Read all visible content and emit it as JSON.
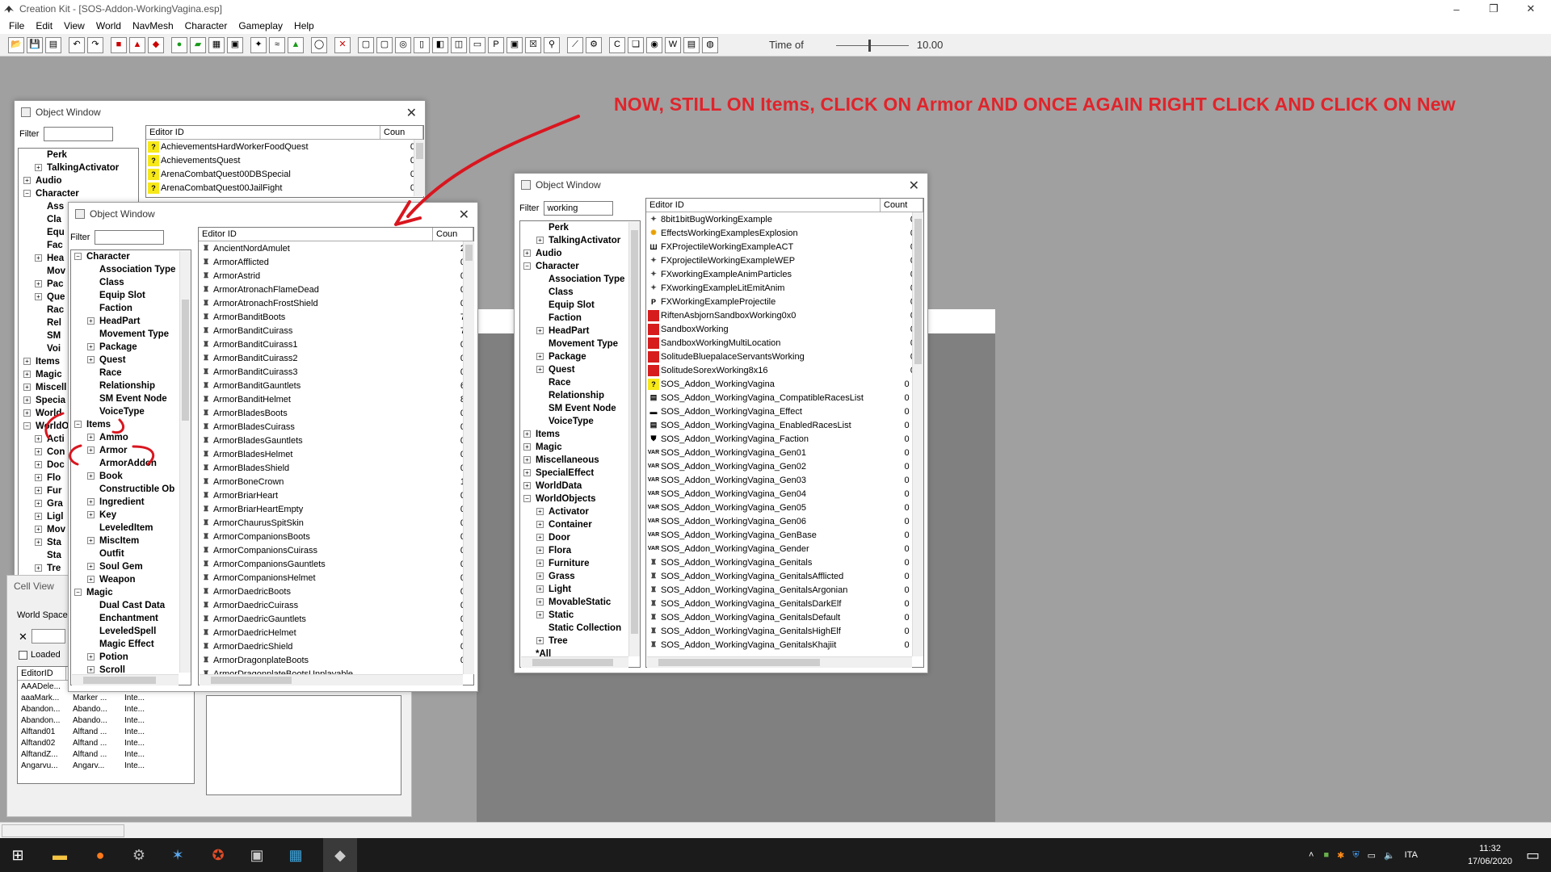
{
  "app": {
    "title": "Creation Kit - [SOS-Addon-WorkingVagina.esp]",
    "menus": [
      "File",
      "Edit",
      "View",
      "World",
      "NavMesh",
      "Character",
      "Gameplay",
      "Help"
    ],
    "time_of_day_label": "Time of",
    "time_of_day_value": "10.00"
  },
  "annotation": {
    "instruction": "NOW, STILL ON  Items, CLICK ON  Armor  AND ONCE AGAIN RIGHT CLICK AND CLICK ON  New",
    "color": "#e0242b"
  },
  "back_object_window": {
    "title": "Object Window",
    "filter_label": "Filter",
    "filter_value": "",
    "tree": [
      "Perk",
      "TalkingActivator",
      "Audio",
      "Character",
      "Ass",
      "Cla",
      "Equ",
      "Fac",
      "Hea",
      "Mov",
      "Pac",
      "Que",
      "Rac",
      "Rel",
      "SM",
      "Voi",
      "Items",
      "Magic",
      "Miscell",
      "Specia",
      "World",
      "WorldO",
      "Acti",
      "Con",
      "Doc",
      "Flo",
      "Fur",
      "Gra",
      "Ligl",
      "Mov",
      "Sta",
      "Sta",
      "Tre"
    ],
    "columns": [
      "Editor ID",
      "Coun"
    ],
    "rows": [
      {
        "name": "AchievementsHardWorkerFoodQuest",
        "count": "0"
      },
      {
        "name": "AchievementsQuest",
        "count": "0"
      },
      {
        "name": "ArenaCombatQuest00DBSpecial",
        "count": "0"
      },
      {
        "name": "ArenaCombatQuest00JailFight",
        "count": "0"
      }
    ]
  },
  "cell_view": {
    "title": "Cell View",
    "world_space_label": "World Space",
    "loaded_label": "Loaded",
    "columns": [
      "EditorID"
    ],
    "rows": [
      [
        "AAADele...",
        "",
        ""
      ],
      [
        "aaaMark...",
        "Marker ...",
        "Inte..."
      ],
      [
        "Abandon...",
        "Abando...",
        "Inte..."
      ],
      [
        "Abandon...",
        "Abando...",
        "Inte..."
      ],
      [
        "Alftand01",
        "Alftand ...",
        "Inte..."
      ],
      [
        "Alftand02",
        "Alftand ...",
        "Inte..."
      ],
      [
        "AlftandZ...",
        "Alftand ...",
        "Inte..."
      ],
      [
        "Angarvu...",
        "Angarv...",
        "Inte..."
      ]
    ]
  },
  "mid_object_window": {
    "title": "Object Window",
    "filter_label": "Filter",
    "filter_value": "",
    "tree": [
      {
        "label": "Character",
        "level": 0,
        "exp": "−"
      },
      {
        "label": "Association Type",
        "level": 1,
        "exp": ""
      },
      {
        "label": "Class",
        "level": 1,
        "exp": ""
      },
      {
        "label": "Equip Slot",
        "level": 1,
        "exp": ""
      },
      {
        "label": "Faction",
        "level": 1,
        "exp": ""
      },
      {
        "label": "HeadPart",
        "level": 1,
        "exp": "+"
      },
      {
        "label": "Movement Type",
        "level": 1,
        "exp": ""
      },
      {
        "label": "Package",
        "level": 1,
        "exp": "+"
      },
      {
        "label": "Quest",
        "level": 1,
        "exp": "+"
      },
      {
        "label": "Race",
        "level": 1,
        "exp": ""
      },
      {
        "label": "Relationship",
        "level": 1,
        "exp": ""
      },
      {
        "label": "SM Event Node",
        "level": 1,
        "exp": ""
      },
      {
        "label": "VoiceType",
        "level": 1,
        "exp": ""
      },
      {
        "label": "Items",
        "level": 0,
        "exp": "−"
      },
      {
        "label": "Ammo",
        "level": 1,
        "exp": "+"
      },
      {
        "label": "Armor",
        "level": 1,
        "exp": "+"
      },
      {
        "label": "ArmorAddon",
        "level": 1,
        "exp": ""
      },
      {
        "label": "Book",
        "level": 1,
        "exp": "+"
      },
      {
        "label": "Constructible Ob",
        "level": 1,
        "exp": ""
      },
      {
        "label": "Ingredient",
        "level": 1,
        "exp": "+"
      },
      {
        "label": "Key",
        "level": 1,
        "exp": "+"
      },
      {
        "label": "LeveledItem",
        "level": 1,
        "exp": ""
      },
      {
        "label": "MiscItem",
        "level": 1,
        "exp": "+"
      },
      {
        "label": "Outfit",
        "level": 1,
        "exp": ""
      },
      {
        "label": "Soul Gem",
        "level": 1,
        "exp": "+"
      },
      {
        "label": "Weapon",
        "level": 1,
        "exp": "+"
      },
      {
        "label": "Magic",
        "level": 0,
        "exp": "−"
      },
      {
        "label": "Dual Cast Data",
        "level": 1,
        "exp": ""
      },
      {
        "label": "Enchantment",
        "level": 1,
        "exp": ""
      },
      {
        "label": "LeveledSpell",
        "level": 1,
        "exp": ""
      },
      {
        "label": "Magic Effect",
        "level": 1,
        "exp": ""
      },
      {
        "label": "Potion",
        "level": 1,
        "exp": "+"
      },
      {
        "label": "Scroll",
        "level": 1,
        "exp": "+"
      }
    ],
    "columns": [
      "Editor ID",
      "Coun"
    ],
    "rows": [
      {
        "name": "AncientNordAmulet",
        "count": "2"
      },
      {
        "name": "ArmorAfflicted",
        "count": "0"
      },
      {
        "name": "ArmorAstrid",
        "count": "0"
      },
      {
        "name": "ArmorAtronachFlameDead",
        "count": "0"
      },
      {
        "name": "ArmorAtronachFrostShield",
        "count": "0"
      },
      {
        "name": "ArmorBanditBoots",
        "count": "7"
      },
      {
        "name": "ArmorBanditCuirass",
        "count": "7"
      },
      {
        "name": "ArmorBanditCuirass1",
        "count": "0"
      },
      {
        "name": "ArmorBanditCuirass2",
        "count": "0"
      },
      {
        "name": "ArmorBanditCuirass3",
        "count": "0"
      },
      {
        "name": "ArmorBanditGauntlets",
        "count": "6"
      },
      {
        "name": "ArmorBanditHelmet",
        "count": "8"
      },
      {
        "name": "ArmorBladesBoots",
        "count": "0"
      },
      {
        "name": "ArmorBladesCuirass",
        "count": "0"
      },
      {
        "name": "ArmorBladesGauntlets",
        "count": "0"
      },
      {
        "name": "ArmorBladesHelmet",
        "count": "0"
      },
      {
        "name": "ArmorBladesShield",
        "count": "0"
      },
      {
        "name": "ArmorBoneCrown",
        "count": "1"
      },
      {
        "name": "ArmorBriarHeart",
        "count": "0"
      },
      {
        "name": "ArmorBriarHeartEmpty",
        "count": "0"
      },
      {
        "name": "ArmorChaurusSpitSkin",
        "count": "0"
      },
      {
        "name": "ArmorCompanionsBoots",
        "count": "0"
      },
      {
        "name": "ArmorCompanionsCuirass",
        "count": "0"
      },
      {
        "name": "ArmorCompanionsGauntlets",
        "count": "0"
      },
      {
        "name": "ArmorCompanionsHelmet",
        "count": "0"
      },
      {
        "name": "ArmorDaedricBoots",
        "count": "0"
      },
      {
        "name": "ArmorDaedricCuirass",
        "count": "0"
      },
      {
        "name": "ArmorDaedricGauntlets",
        "count": "0"
      },
      {
        "name": "ArmorDaedricHelmet",
        "count": "0"
      },
      {
        "name": "ArmorDaedricShield",
        "count": "0"
      },
      {
        "name": "ArmorDragonplateBoots",
        "count": "0"
      },
      {
        "name": "ArmorDragonplateBootsUnplayable",
        "count": ""
      }
    ]
  },
  "right_object_window": {
    "title": "Object Window",
    "filter_label": "Filter",
    "filter_value": "working",
    "tree": [
      {
        "label": "Perk",
        "level": 1,
        "exp": ""
      },
      {
        "label": "TalkingActivator",
        "level": 1,
        "exp": "+"
      },
      {
        "label": "Audio",
        "level": 0,
        "exp": "+"
      },
      {
        "label": "Character",
        "level": 0,
        "exp": "−"
      },
      {
        "label": "Association Type",
        "level": 1,
        "exp": ""
      },
      {
        "label": "Class",
        "level": 1,
        "exp": ""
      },
      {
        "label": "Equip Slot",
        "level": 1,
        "exp": ""
      },
      {
        "label": "Faction",
        "level": 1,
        "exp": ""
      },
      {
        "label": "HeadPart",
        "level": 1,
        "exp": "+"
      },
      {
        "label": "Movement Type",
        "level": 1,
        "exp": ""
      },
      {
        "label": "Package",
        "level": 1,
        "exp": "+"
      },
      {
        "label": "Quest",
        "level": 1,
        "exp": "+"
      },
      {
        "label": "Race",
        "level": 1,
        "exp": ""
      },
      {
        "label": "Relationship",
        "level": 1,
        "exp": ""
      },
      {
        "label": "SM Event Node",
        "level": 1,
        "exp": ""
      },
      {
        "label": "VoiceType",
        "level": 1,
        "exp": ""
      },
      {
        "label": "Items",
        "level": 0,
        "exp": "+"
      },
      {
        "label": "Magic",
        "level": 0,
        "exp": "+"
      },
      {
        "label": "Miscellaneous",
        "level": 0,
        "exp": "+"
      },
      {
        "label": "SpecialEffect",
        "level": 0,
        "exp": "+"
      },
      {
        "label": "WorldData",
        "level": 0,
        "exp": "+"
      },
      {
        "label": "WorldObjects",
        "level": 0,
        "exp": "−"
      },
      {
        "label": "Activator",
        "level": 1,
        "exp": "+"
      },
      {
        "label": "Container",
        "level": 1,
        "exp": "+"
      },
      {
        "label": "Door",
        "level": 1,
        "exp": "+"
      },
      {
        "label": "Flora",
        "level": 1,
        "exp": "+"
      },
      {
        "label": "Furniture",
        "level": 1,
        "exp": "+"
      },
      {
        "label": "Grass",
        "level": 1,
        "exp": "+"
      },
      {
        "label": "Light",
        "level": 1,
        "exp": "+"
      },
      {
        "label": "MovableStatic",
        "level": 1,
        "exp": "+"
      },
      {
        "label": "Static",
        "level": 1,
        "exp": "+"
      },
      {
        "label": "Static Collection",
        "level": 1,
        "exp": ""
      },
      {
        "label": "Tree",
        "level": 1,
        "exp": "+"
      },
      {
        "label": "*All",
        "level": 0,
        "exp": ""
      }
    ],
    "columns": [
      "Editor ID",
      "Count"
    ],
    "rows": [
      {
        "name": "8bit1bitBugWorkingExample",
        "count": "0",
        "icon": "fx"
      },
      {
        "name": "EffectsWorkingExamplesExplosion",
        "count": "0",
        "icon": "explosion"
      },
      {
        "name": "FXProjectileWorkingExampleACT",
        "count": "0",
        "icon": "act"
      },
      {
        "name": "FXprojectileWorkingExampleWEP",
        "count": "0",
        "icon": "fx"
      },
      {
        "name": "FXworkingExampleAnimParticles",
        "count": "0",
        "icon": "fx"
      },
      {
        "name": "FXworkingExampleLitEmitAnim",
        "count": "0",
        "icon": "fx"
      },
      {
        "name": "FXWorkingExampleProjectile",
        "count": "0",
        "icon": "p"
      },
      {
        "name": "RiftenAsbjornSandboxWorking0x0",
        "count": "0",
        "icon": "red"
      },
      {
        "name": "SandboxWorking",
        "count": "0",
        "icon": "red"
      },
      {
        "name": "SandboxWorkingMultiLocation",
        "count": "0",
        "icon": "red"
      },
      {
        "name": "SolitudeBluepalaceServantsWorking",
        "count": "0",
        "icon": "red"
      },
      {
        "name": "SolitudeSorexWorking8x16",
        "count": "0",
        "icon": "red"
      },
      {
        "name": "SOS_Addon_WorkingVagina",
        "count": "0 *",
        "icon": "q"
      },
      {
        "name": "SOS_Addon_WorkingVagina_CompatibleRacesList",
        "count": "0 *",
        "icon": "list"
      },
      {
        "name": "SOS_Addon_WorkingVagina_Effect",
        "count": "0 *",
        "icon": "effect"
      },
      {
        "name": "SOS_Addon_WorkingVagina_EnabledRacesList",
        "count": "0 *",
        "icon": "list"
      },
      {
        "name": "SOS_Addon_WorkingVagina_Faction",
        "count": "0 *",
        "icon": "faction"
      },
      {
        "name": "SOS_Addon_WorkingVagina_Gen01",
        "count": "0 *",
        "icon": "var"
      },
      {
        "name": "SOS_Addon_WorkingVagina_Gen02",
        "count": "0 *",
        "icon": "var"
      },
      {
        "name": "SOS_Addon_WorkingVagina_Gen03",
        "count": "0 *",
        "icon": "var"
      },
      {
        "name": "SOS_Addon_WorkingVagina_Gen04",
        "count": "0 *",
        "icon": "var"
      },
      {
        "name": "SOS_Addon_WorkingVagina_Gen05",
        "count": "0 *",
        "icon": "var"
      },
      {
        "name": "SOS_Addon_WorkingVagina_Gen06",
        "count": "0 *",
        "icon": "var"
      },
      {
        "name": "SOS_Addon_WorkingVagina_GenBase",
        "count": "0 *",
        "icon": "var"
      },
      {
        "name": "SOS_Addon_WorkingVagina_Gender",
        "count": "0 *",
        "icon": "var"
      },
      {
        "name": "SOS_Addon_WorkingVagina_Genitals",
        "count": "0 *",
        "icon": "armor"
      },
      {
        "name": "SOS_Addon_WorkingVagina_GenitalsAfflicted",
        "count": "0 *",
        "icon": "armor"
      },
      {
        "name": "SOS_Addon_WorkingVagina_GenitalsArgonian",
        "count": "0 *",
        "icon": "armor"
      },
      {
        "name": "SOS_Addon_WorkingVagina_GenitalsDarkElf",
        "count": "0 *",
        "icon": "armor"
      },
      {
        "name": "SOS_Addon_WorkingVagina_GenitalsDefault",
        "count": "0 *",
        "icon": "armor"
      },
      {
        "name": "SOS_Addon_WorkingVagina_GenitalsHighElf",
        "count": "0 *",
        "icon": "armor"
      },
      {
        "name": "SOS_Addon_WorkingVagina_GenitalsKhajiit",
        "count": "0 *",
        "icon": "armor"
      }
    ]
  },
  "taskbar": {
    "language": "ITA",
    "time": "11:32",
    "date": "17/06/2020"
  }
}
